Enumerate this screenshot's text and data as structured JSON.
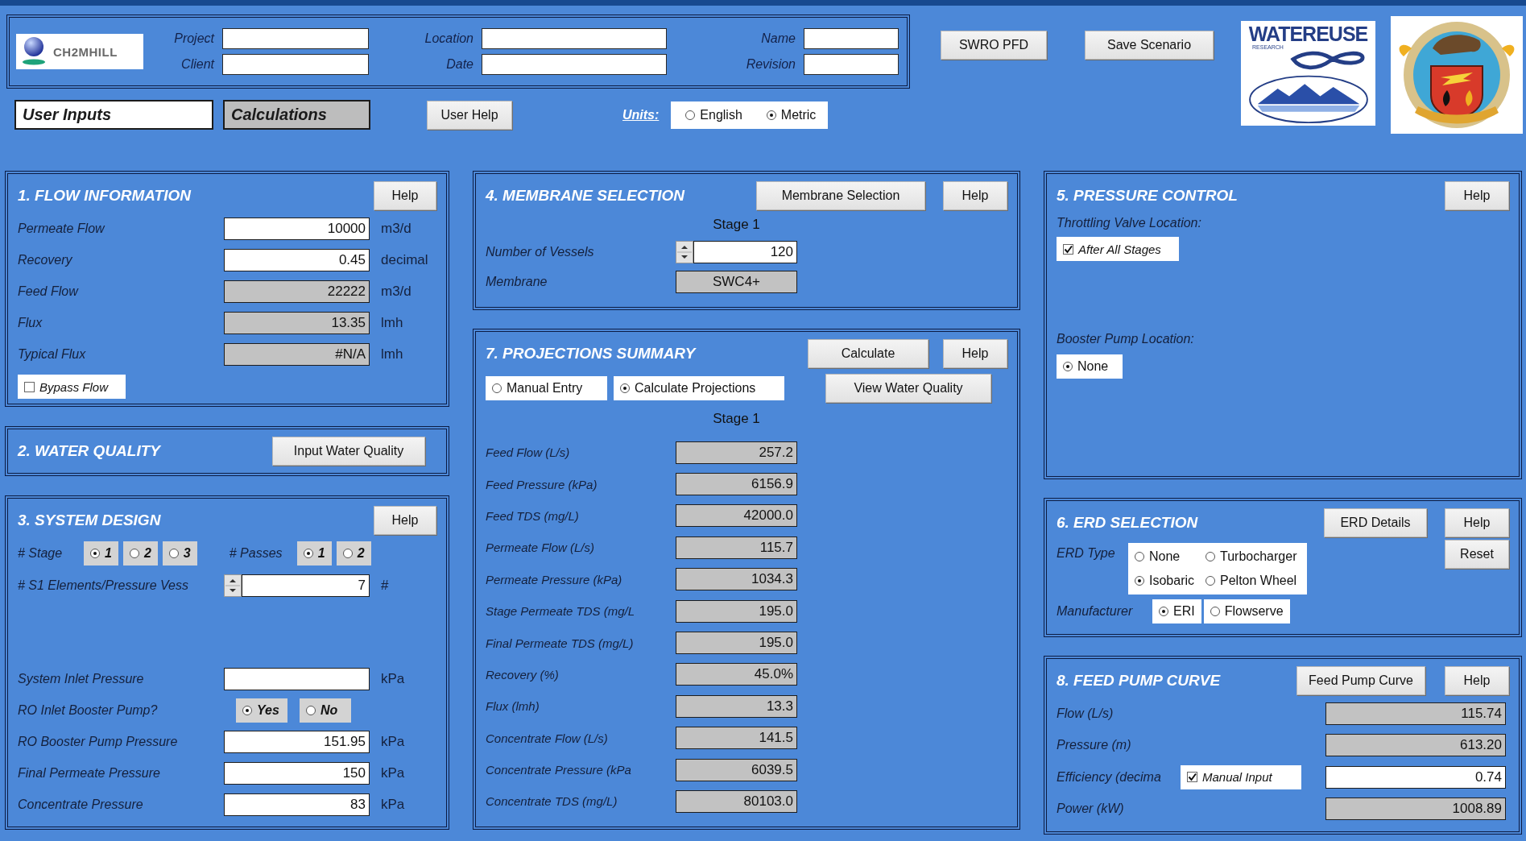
{
  "header": {
    "logo_text": "CH2MHILL",
    "fields": [
      {
        "label": "Project"
      },
      {
        "label": "Location"
      },
      {
        "label": "Name"
      },
      {
        "label": "Client"
      },
      {
        "label": "Date"
      },
      {
        "label": "Revision"
      }
    ],
    "buttons": [
      "SWRO PFD",
      "Save Scenario"
    ],
    "partner_logo": {
      "title": "WATEREUSE",
      "subtitle": "RESEARCH"
    }
  },
  "sheet_tabs": [
    {
      "label": "User Inputs",
      "selected": true
    },
    {
      "label": "Calculations",
      "selected": false
    }
  ],
  "user_help_button": "User Help",
  "units": {
    "label": "Units:",
    "options": [
      {
        "label": "English",
        "selected": false
      },
      {
        "label": "Metric",
        "selected": true
      }
    ]
  },
  "flow_information": {
    "title": "1. FLOW INFORMATION",
    "buttons": [
      "Help"
    ],
    "rows": [
      {
        "label": "Permeate Flow",
        "value": "10000",
        "unit": "m3/d",
        "readonly": false
      },
      {
        "label": "Recovery",
        "value": "0.45",
        "unit": "decimal",
        "readonly": false
      },
      {
        "label": "Feed Flow",
        "value": "22222",
        "unit": "m3/d",
        "readonly": true
      },
      {
        "label": "Flux",
        "value": "13.35",
        "unit": "lmh",
        "readonly": true
      },
      {
        "label": "Typical Flux",
        "value": "#N/A",
        "unit": "lmh",
        "readonly": true
      }
    ],
    "bypass": {
      "label": "Bypass Flow",
      "checked": false
    }
  },
  "water_quality": {
    "title": "2. WATER QUALITY",
    "buttons": [
      "Input Water Quality"
    ]
  },
  "system_design": {
    "title": "3. SYSTEM DESIGN",
    "buttons": [
      "Help"
    ],
    "stages": {
      "label": "# Stage",
      "options": [
        {
          "label": "1",
          "selected": true
        },
        {
          "label": "2",
          "selected": false
        },
        {
          "label": "3",
          "selected": false
        }
      ]
    },
    "passes": {
      "label": "# Passes",
      "options": [
        {
          "label": "1",
          "selected": true
        },
        {
          "label": "2",
          "selected": false
        }
      ]
    },
    "elements": {
      "label": "# S1 Elements/Pressure Vess",
      "value": "7",
      "unit": "#"
    },
    "rows": [
      {
        "kind": "field",
        "label": "System Inlet Pressure",
        "unit": "kPa",
        "readonly": false
      },
      {
        "kind": "radios",
        "label": "RO Inlet Booster Pump?",
        "options": [
          {
            "label": "Yes",
            "selected": true
          },
          {
            "label": "No",
            "selected": false
          }
        ]
      },
      {
        "kind": "field",
        "label": "RO Booster Pump Pressure",
        "value": "151.95",
        "unit": "kPa",
        "readonly": false
      },
      {
        "kind": "field",
        "label": "Final Permeate Pressure",
        "value": "150",
        "unit": "kPa",
        "readonly": false
      },
      {
        "kind": "field",
        "label": "Concentrate Pressure",
        "value": "83",
        "unit": "kPa",
        "readonly": false
      }
    ]
  },
  "membrane_selection": {
    "title": "4. MEMBRANE SELECTION",
    "buttons": [
      "Membrane Selection",
      "Help"
    ],
    "stage": "Stage 1",
    "vessels": {
      "label": "Number of Vessels",
      "value": "120"
    },
    "membrane": {
      "label": "Membrane",
      "value": "SWC4+"
    }
  },
  "projections_summary": {
    "title": "7. PROJECTIONS SUMMARY",
    "buttons": [
      "Calculate",
      "Help"
    ],
    "view_button": "View Water Quality",
    "modes": [
      {
        "label": "Manual Entry",
        "selected": false
      },
      {
        "label": "Calculate Projections",
        "selected": true
      }
    ],
    "stage": "Stage 1",
    "rows": [
      {
        "label": "Feed Flow (L/s)",
        "value": "257.2"
      },
      {
        "label": "Feed Pressure (kPa)",
        "value": "6156.9"
      },
      {
        "label": "Feed TDS (mg/L)",
        "value": "42000.0"
      },
      {
        "label": "Permeate Flow (L/s)",
        "value": "115.7"
      },
      {
        "label": "Permeate Pressure (kPa)",
        "value": "1034.3"
      },
      {
        "label": "Stage Permeate TDS (mg/L",
        "value": "195.0"
      },
      {
        "label": "Final Permeate TDS (mg/L)",
        "value": "195.0"
      },
      {
        "label": "Recovery (%)",
        "value": "45.0%"
      },
      {
        "label": "Flux (lmh)",
        "value": "13.3"
      },
      {
        "label": "Concentrate Flow (L/s)",
        "value": "141.5"
      },
      {
        "label": "Concentrate Pressure (kPa",
        "value": "6039.5"
      },
      {
        "label": "Concentrate TDS (mg/L)",
        "value": "80103.0"
      }
    ]
  },
  "pressure_control": {
    "title": "5. PRESSURE CONTROL",
    "buttons": [
      "Help"
    ],
    "throttling": {
      "label": "Throttling Valve Location:",
      "option": {
        "label": "After All Stages",
        "checked": true
      }
    },
    "booster": {
      "label": "Booster Pump Location:",
      "options": [
        {
          "label": "None",
          "selected": true
        }
      ]
    }
  },
  "erd_selection": {
    "title": "6. ERD SELECTION",
    "buttons": [
      "ERD Details",
      "Help"
    ],
    "reset_button": "Reset",
    "erd_type": {
      "label": "ERD Type",
      "options": [
        {
          "label": "None",
          "selected": false
        },
        {
          "label": "Turbocharger",
          "selected": false
        },
        {
          "label": "Isobaric",
          "selected": true
        },
        {
          "label": "Pelton Wheel",
          "selected": false
        }
      ]
    },
    "manufacturer": {
      "label": "Manufacturer",
      "options": [
        {
          "label": "ERI",
          "selected": true
        },
        {
          "label": "Flowserve",
          "selected": false
        }
      ]
    }
  },
  "feed_pump_curve": {
    "title": "8. FEED PUMP CURVE",
    "buttons": [
      "Feed Pump Curve",
      "Help"
    ],
    "rows": [
      {
        "label": "Flow (L/s)",
        "value": "115.74",
        "readonly": true
      },
      {
        "label": "Pressure (m)",
        "value": "613.20",
        "readonly": true
      },
      {
        "label": "Efficiency (decima",
        "value": "0.74",
        "readonly": false,
        "option": {
          "label": "Manual Input",
          "checked": true
        }
      },
      {
        "label": "Power (kW)",
        "value": "1008.89",
        "readonly": true
      }
    ]
  }
}
